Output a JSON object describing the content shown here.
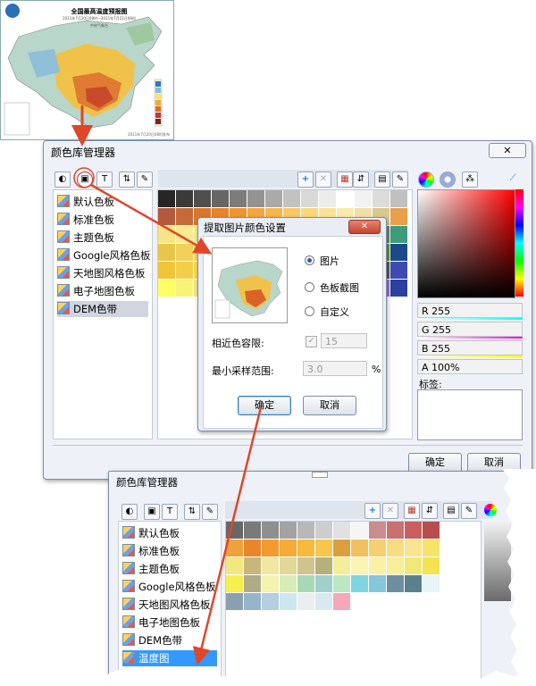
{
  "map": {
    "title": "全国最高温度预报图",
    "subtitle1": "2011年7月20日08时—2011年7月21日08时",
    "subtitle2": "中央气象台",
    "footer": "2011年7月20日08时发布"
  },
  "manager": {
    "title": "颜色库管理器",
    "close_icon": "close-icon",
    "palette_list": [
      "默认色板",
      "标准色板",
      "主题色板",
      "Google风格色板",
      "天地图风格色板",
      "电子地图色板",
      "DEM色带"
    ],
    "selected": "DEM色带",
    "channels": {
      "r": "R 255",
      "g": "G 255",
      "b": "B 255",
      "a": "A 100%"
    },
    "tag_label": "标签:",
    "ok": "确定",
    "cancel": "取消",
    "swatches": [
      [
        "#262626",
        "#3a3a3a",
        "#4f4f4f",
        "#666666",
        "#7c7c7c",
        "#939393",
        "#aaaaaa",
        "#c2c2c2",
        "#d9d9d9",
        "#ececec",
        "#ffffff",
        "#f2f2f2",
        "#dcdcdc",
        "#c0c0c0"
      ],
      [
        "#b35a3c",
        "#c66a3a",
        "#d9782d",
        "#e6862a",
        "#f0952e",
        "#f5a53d",
        "#f7b64d",
        "#f9c865",
        "#fad779",
        "#fbe394",
        "#fbeaab",
        "#f1e0a5",
        "#d9c98c",
        "#e8a04a"
      ],
      [
        "#f6e487",
        "#f8ea8d",
        "#f4ee97",
        "#eee38f",
        "#e3d98b",
        "#d6d08a",
        "#c8c684",
        "#b7bc80",
        "#a7b07a",
        "#97a672",
        "#869b6b",
        "#7a9270",
        "#6f8b75",
        "#3e9c7a"
      ],
      [
        "#e8c64a",
        "#efd05a",
        "#f5da6a",
        "#f9e380",
        "#f3e06e",
        "#e9d45a",
        "#d9c448",
        "#c7b43a",
        "#b6a230",
        "#9e8a26",
        "#8d7a22",
        "#7b6a1d",
        "#67981f",
        "#1a4a8a"
      ],
      [
        "#f2c43a",
        "#f3cf49",
        "#f4da59",
        "#f5e569",
        "#e5d867",
        "#d4c965",
        "#c2ba62",
        "#b1aa60",
        "#a09a5d",
        "#8e8a5a",
        "#7d7a57",
        "#6b6a54",
        "#5a5a51",
        "#3d4bb0"
      ],
      [
        "#ffff66",
        "#f7f37a",
        "#efe78e",
        "#e7dba2",
        "#dfcfb6",
        "#d7c3ca",
        "#cfb7de",
        "#c7abf2",
        "#bf9fff",
        "#b793f5",
        "#af87eb",
        "#a77be1",
        "#9f6fd7",
        "#2c3e9e"
      ]
    ],
    "toolbar_icons": [
      "palette-icon",
      "import-image-icon",
      "text-icon",
      "move-icon",
      "edit-icon"
    ],
    "grid_toolbar_icons": [
      "add-icon",
      "delete-icon",
      "delete-red-icon",
      "sort-icon",
      "grid-icon",
      "edit2-icon"
    ],
    "picker_icons": [
      "color-wheel-icon",
      "hue-ring-icon",
      "color-dots-icon",
      "eyedropper-icon"
    ]
  },
  "dialog": {
    "title": "提取图片颜色设置",
    "options": [
      "图片",
      "色板截图",
      "自定义"
    ],
    "selected_option": "图片",
    "tolerance_label": "相近色容限:",
    "tolerance_value": "15",
    "sample_label": "最小采样范围:",
    "sample_value": "3.0",
    "sample_unit": "%",
    "ok": "确定",
    "cancel": "取消"
  },
  "result": {
    "title": "颜色库管理器",
    "palette_list": [
      "默认色板",
      "标准色板",
      "主题色板",
      "Google风格色板",
      "天地图风格色板",
      "电子地图色板",
      "DEM色带",
      "温度图"
    ],
    "selected": "温度图",
    "swatches": [
      [
        "#676767",
        "#7a7a7a",
        "#8f8f8f",
        "#a3a3a3",
        "#b8b8b8",
        "#cdcdcd",
        "#e1e1e1",
        "#f5f5f5",
        "#c98d8d",
        "#c97070",
        "#c96060",
        "#b84d4d"
      ],
      [
        "#f0a23a",
        "#e8862a",
        "#f29a2e",
        "#f6ab35",
        "#f7b93f",
        "#f8c64c",
        "#d9a040",
        "#f0c060",
        "#f6d070",
        "#f8dc80",
        "#f9e590",
        "#f6e46a"
      ],
      [
        "#f3e780",
        "#c9b67b",
        "#f2e7a0",
        "#e1d89a",
        "#cfc58c",
        "#b7b07b",
        "#f4ee9b",
        "#faf5b0",
        "#f8f2a6",
        "#f7ef98",
        "#f2e879",
        "#f4e24e"
      ],
      [
        "#f5f04e",
        "#aeab89",
        "#f4f3b0",
        "#d8edb8",
        "#a7d9b8",
        "#a0d0cc",
        "#bce7c4",
        "#7fd6e2",
        "#85c6da",
        "#6f8fa0",
        "#5a808e",
        "#e5f5f8"
      ],
      [
        "#8aa0b0",
        "#95b5c8",
        "#b3cfe0",
        "#cde6f0",
        "#e9eef1",
        "#d8e9f1",
        "#f4a8b8"
      ]
    ]
  }
}
